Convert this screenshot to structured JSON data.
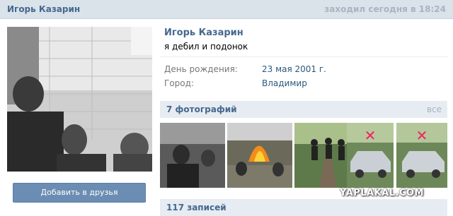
{
  "topbar": {
    "name": "Игорь Казарин",
    "last_seen": "заходил сегодня в 18:24"
  },
  "profile": {
    "name": "Игорь Казарин",
    "status": "я дебил и подонок",
    "birthday_label": "День рождения:",
    "birthday_value": "23 мая 2001 г.",
    "city_label": "Город:",
    "city_value": "Владимир"
  },
  "actions": {
    "add_friend_label": "Добавить в друзья"
  },
  "photos": {
    "header": "7 фотографий",
    "all_link": "все",
    "items": [
      {
        "icon": "photo-group-selfie"
      },
      {
        "icon": "photo-fire"
      },
      {
        "icon": "photo-railway"
      },
      {
        "icon": "photo-car"
      },
      {
        "icon": "photo-car-2"
      }
    ]
  },
  "posts": {
    "header": "117 записей"
  },
  "watermark": "YAPLAKAL.COM",
  "colors": {
    "accent": "#45688e",
    "button": "#6b8db3",
    "topbar": "#dae2ea"
  }
}
